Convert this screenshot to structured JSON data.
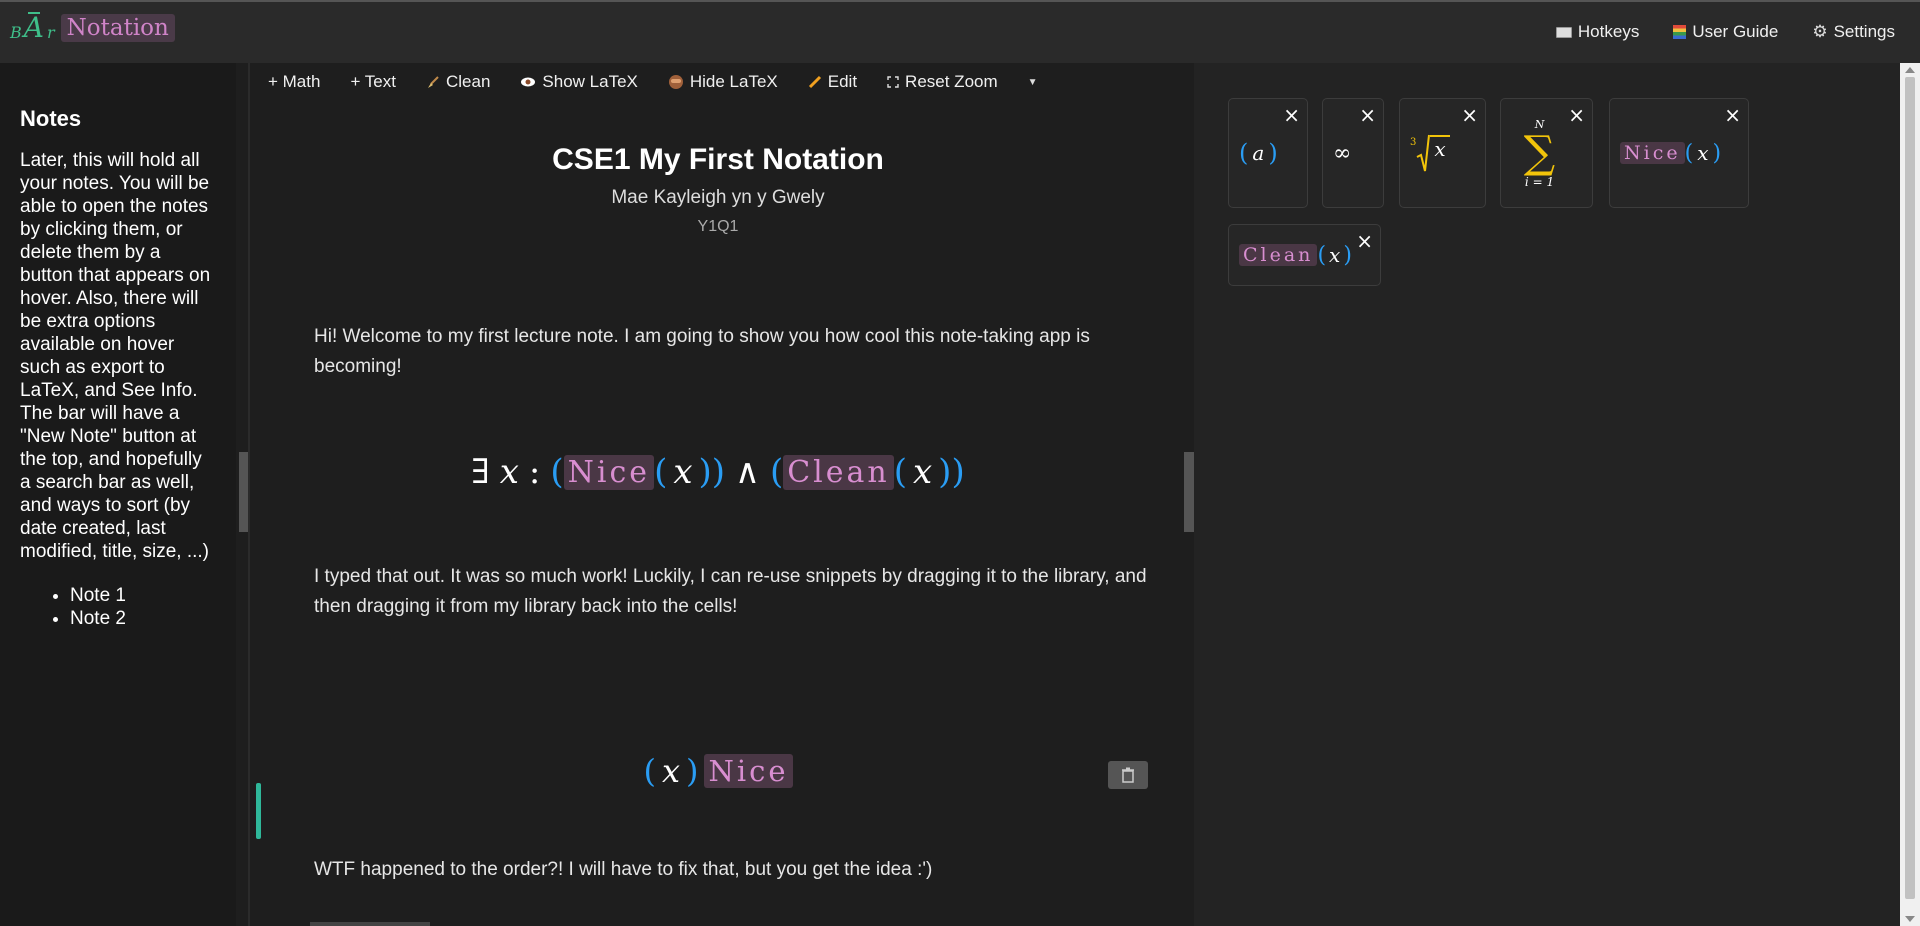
{
  "brand": {
    "b": "B",
    "a": "A",
    "r": "r",
    "name": "Notation"
  },
  "topnav": {
    "hotkeys": "Hotkeys",
    "guide": "User Guide",
    "settings": "Settings"
  },
  "sidebar": {
    "title": "Notes",
    "description": "Later, this will hold all your notes. You will be able to open the notes by clicking them, or delete them by a button that appears on hover. Also, there will be extra options available on hover such as export to LaTeX, and See Info. The bar will have a \"New Note\" button at the top, and hopefully a search bar as well, and ways to sort (by date created, last modified, title, size, ...)",
    "notes": [
      "Note 1",
      "Note 2"
    ]
  },
  "toolbar": {
    "add_math": "+ Math",
    "add_text": "+ Text",
    "clean": "Clean",
    "show_latex": "Show LaTeX",
    "hide_latex": "Hide LaTeX",
    "edit": "Edit",
    "reset_zoom": "Reset Zoom"
  },
  "note": {
    "title": "CSE1 My First Notation",
    "author": "Mae Kayleigh yn y Gwely",
    "term": "Y1Q1",
    "cells": [
      "Hi! Welcome to my first lecture note. I am going to show you how cool this note-taking app is becoming!",
      "I typed that out. It was so much work! Luckily, I can re-use snippets by dragging it to the library, and then dragging it from my library back into the cells!",
      "WTF happened to the order?! I will have to fix that, but you get the idea :')"
    ],
    "math1": {
      "exists": "∃",
      "var": "x",
      "colon": ":",
      "fn1": "Nice",
      "and": "∧",
      "fn2": "Clean",
      "lp": "(",
      "rp": ")"
    },
    "math2": {
      "var": "x",
      "fn": "Nice",
      "lp": "(",
      "rp": ")"
    }
  },
  "library": {
    "close": "×",
    "snippets": {
      "a": "a",
      "infinity": "∞",
      "root_index": "3",
      "root_var": "x",
      "sum_upper": "N",
      "sum_lower": "i = 1",
      "nice": "Nice",
      "clean": "Clean",
      "x": "x",
      "lp": "(",
      "rp": ")"
    }
  },
  "colors": {
    "accent_green": "#2fb89a",
    "paren_blue": "#2a9df4",
    "fn_pink": "#d88ed0",
    "sum_yellow": "#f2c40a"
  }
}
